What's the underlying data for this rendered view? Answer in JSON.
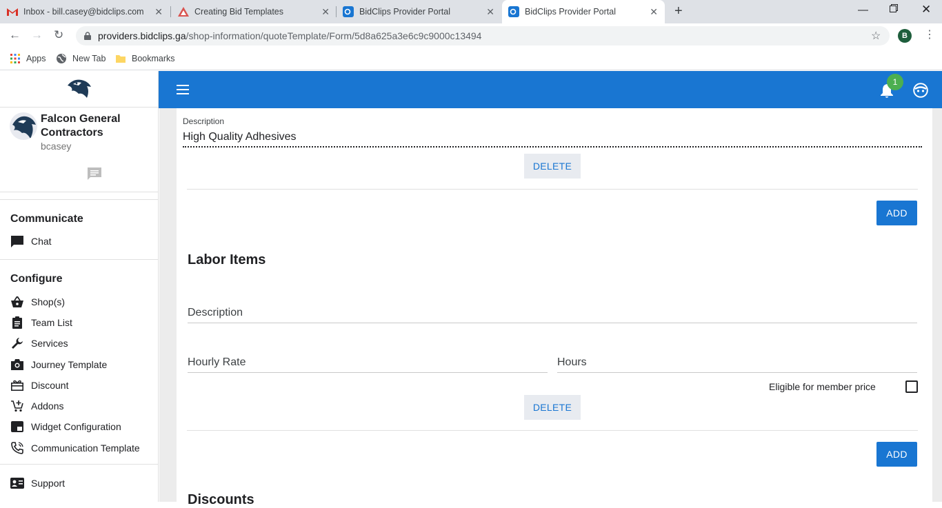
{
  "browser": {
    "tabs": [
      {
        "title": "Inbox - bill.casey@bidclips.com -"
      },
      {
        "title": "Creating Bid Templates"
      },
      {
        "title": "BidClips Provider Portal"
      },
      {
        "title": "BidClips Provider Portal"
      }
    ],
    "url_host": "providers.bidclips.ga",
    "url_path": "/shop-information/quoteTemplate/Form/5d8a625a3e6c9c9000c13494",
    "profile_initial": "B",
    "bookmarks": [
      {
        "label": "Apps"
      },
      {
        "label": "New Tab"
      },
      {
        "label": "Bookmarks"
      }
    ]
  },
  "sidebar": {
    "company_name": "Falcon General Contractors",
    "username": "bcasey",
    "sections": [
      {
        "title": "Communicate",
        "items": [
          {
            "label": "Chat",
            "icon": "chat-icon"
          }
        ]
      },
      {
        "title": "Configure",
        "items": [
          {
            "label": "Shop(s)",
            "icon": "basket-icon"
          },
          {
            "label": "Team List",
            "icon": "clipboard-icon"
          },
          {
            "label": "Services",
            "icon": "wrench-icon"
          },
          {
            "label": "Journey Template",
            "icon": "camera-icon"
          },
          {
            "label": "Discount",
            "icon": "gift-icon"
          },
          {
            "label": "Addons",
            "icon": "cart-add-icon"
          },
          {
            "label": "Widget Configuration",
            "icon": "widget-icon"
          },
          {
            "label": "Communication Template",
            "icon": "phone-icon"
          }
        ]
      }
    ],
    "support": {
      "label": "Support",
      "icon": "contact-card-icon"
    }
  },
  "appbar": {
    "notification_count": "1",
    "brand_color": "#1976d2"
  },
  "form": {
    "top_item": {
      "description_label": "Description",
      "description_value": "High Quality Adhesives",
      "delete_label": "DELETE"
    },
    "add_label": "ADD",
    "labor": {
      "title": "Labor Items",
      "description_label": "Description",
      "hourly_rate_label": "Hourly Rate",
      "hours_label": "Hours",
      "eligible_label": "Eligible for member price",
      "eligible_checked": false,
      "delete_label": "DELETE",
      "add_label": "ADD"
    },
    "discounts_title": "Discounts"
  }
}
